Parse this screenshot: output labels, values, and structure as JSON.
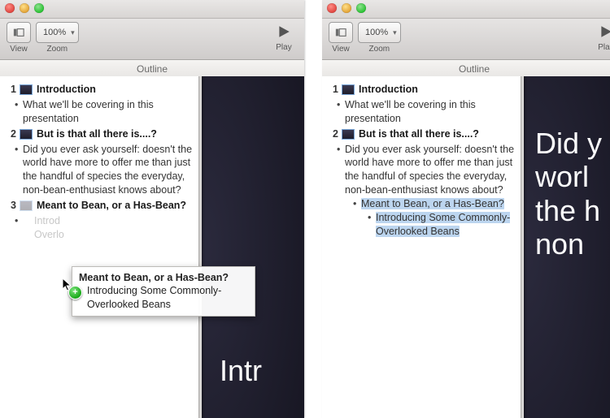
{
  "toolbar": {
    "view_label": "View",
    "zoom_label": "Zoom",
    "zoom_value": "100%",
    "play_label": "Play"
  },
  "outline_header": "Outline",
  "slides_left": [
    {
      "n": "1",
      "title": "Introduction",
      "bullets": [
        "What we'll be covering in this presentation"
      ]
    },
    {
      "n": "2",
      "title": "But is that all there is....?",
      "bullets": [
        "Did you ever ask yourself: doesn't the world have more to offer me than just the handful of species the everyday, non-bean-enthusiast knows about?"
      ]
    },
    {
      "n": "3",
      "title": "Meant to Bean, or a Has-Bean?",
      "faded": true,
      "bullets_faded": [
        "Introducing Some Commonly-Overlooked Beans"
      ]
    }
  ],
  "drag_ghost": {
    "title": "Meant to Bean, or a Has-Bean?",
    "bullet": "Introducing Some Commonly-Overlooked Beans",
    "badge": "+"
  },
  "slides_right": [
    {
      "n": "1",
      "title": "Introduction",
      "bullets": [
        "What we'll be covering in this presentation"
      ]
    },
    {
      "n": "2",
      "title": "But is that all there is....?",
      "bullets": [
        "Did you ever ask yourself: doesn't the world have more to offer me than just the handful of species the everyday, non-bean-enthusiast knows about?"
      ],
      "sub1_selected": "Meant to Bean, or a Has-Bean?",
      "sub2a": "Introducing Some Commonly-Overlooked Beans"
    }
  ],
  "slide_preview_left": {
    "line2": "Intr"
  },
  "slide_preview_right": {
    "line1": "Did y\nworl\nthe h\nnon",
    "line2": ""
  }
}
